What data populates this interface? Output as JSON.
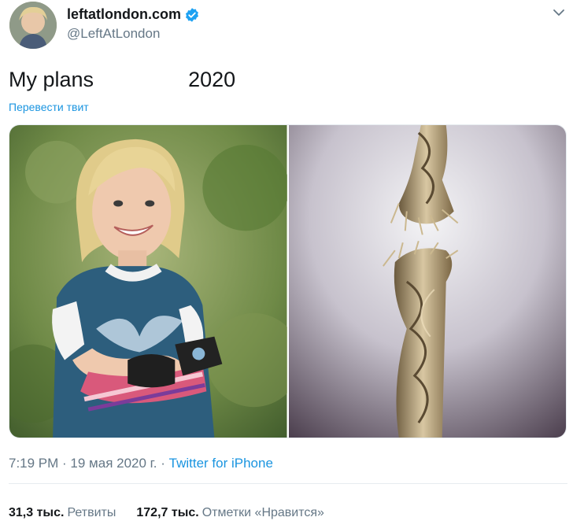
{
  "author": {
    "display_name": "leftatlondon.com",
    "handle": "@LeftAtLondon",
    "verified_icon": "verified-badge-icon"
  },
  "tweet": {
    "text": "My plans                2020",
    "translate_label": "Перевести твит"
  },
  "media": [
    {
      "icon": "photo-smiling-girl"
    },
    {
      "icon": "photo-fraying-rope"
    }
  ],
  "meta": {
    "time": "7:19 PM",
    "separator": " · ",
    "date": "19 мая 2020 г.",
    "source": "Twitter for iPhone"
  },
  "stats": {
    "retweets_count": "31,3 тыс.",
    "retweets_label": "Ретвиты",
    "likes_count": "172,7 тыс.",
    "likes_label": "Отметки «Нравится»"
  },
  "colors": {
    "link": "#1b95e0",
    "secondary_text": "#657786",
    "primary_text": "#14171a",
    "divider": "#e6ecf0"
  }
}
